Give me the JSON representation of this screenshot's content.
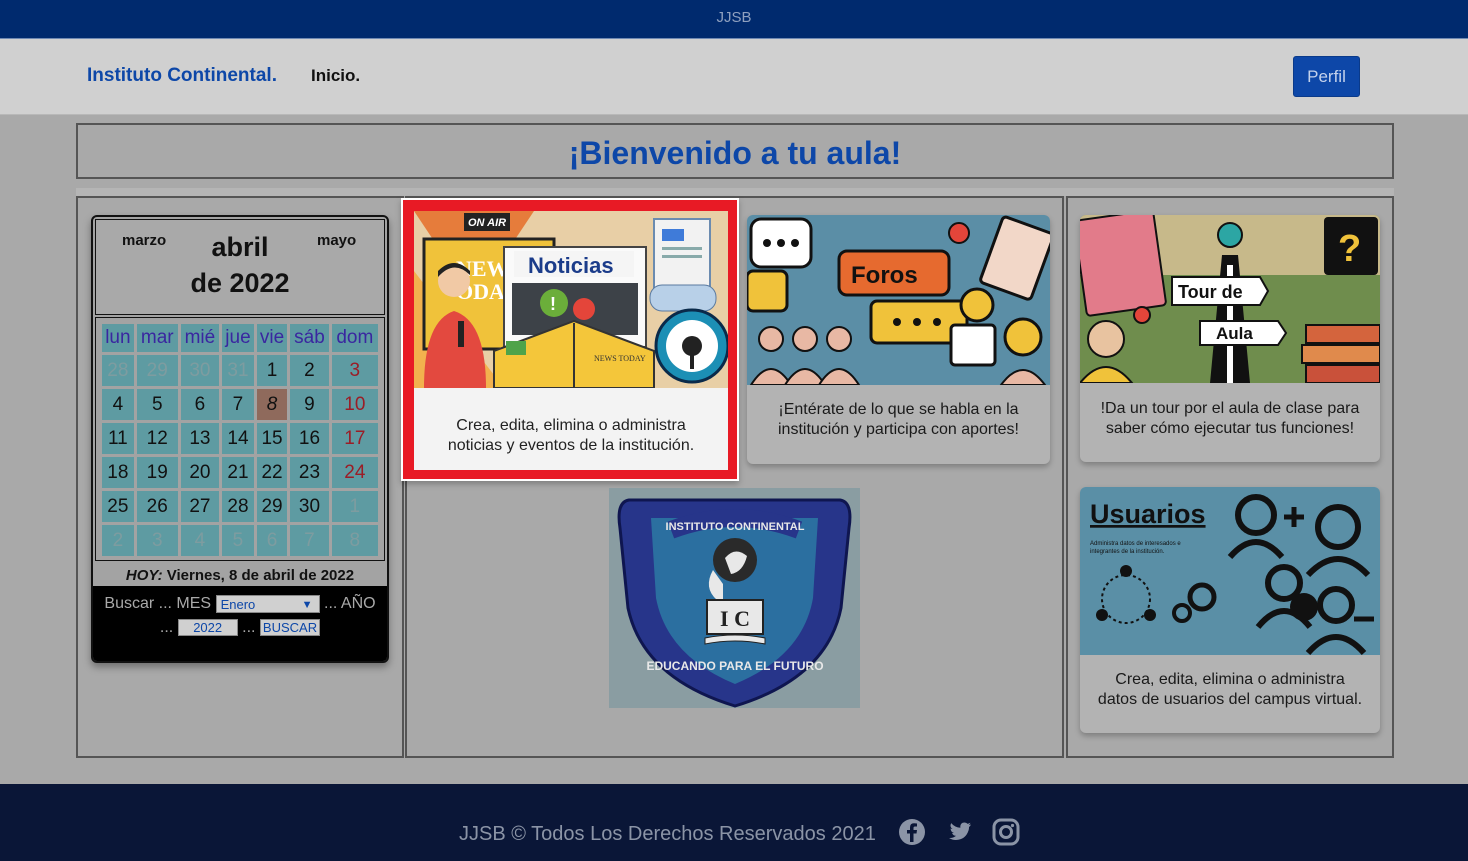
{
  "topbar": {
    "title": "JJSB"
  },
  "navbar": {
    "brand": "Instituto Continental.",
    "home_link": "Inicio.",
    "profile_button": "Perfil"
  },
  "welcome": {
    "heading": "¡Bienvenido a tu aula!"
  },
  "calendar": {
    "prev_month": "marzo",
    "month": "abril",
    "year_line": "de 2022",
    "next_month": "mayo",
    "weekdays": [
      "lun",
      "mar",
      "mié",
      "jue",
      "vie",
      "sáb",
      "dom"
    ],
    "weeks": [
      [
        "28",
        "29",
        "30",
        "31",
        "1",
        "2",
        "3"
      ],
      [
        "4",
        "5",
        "6",
        "7",
        "8",
        "9",
        "10"
      ],
      [
        "11",
        "12",
        "13",
        "14",
        "15",
        "16",
        "17"
      ],
      [
        "18",
        "19",
        "20",
        "21",
        "22",
        "23",
        "24"
      ],
      [
        "25",
        "26",
        "27",
        "28",
        "29",
        "30",
        "1"
      ],
      [
        "2",
        "3",
        "4",
        "5",
        "6",
        "7",
        "8"
      ]
    ],
    "today_label": "HOY:",
    "today_value": "Viernes, 8 de abril de 2022",
    "search": {
      "buscar_label": "Buscar ... MES",
      "month_value": "Enero",
      "year_label": "... AÑO",
      "dots": "...",
      "year_value": "2022",
      "dots2": "...",
      "button": "BUSCAR"
    }
  },
  "cards": {
    "noticias": {
      "title": "Noticias",
      "badge": "ON AIR",
      "description": "Crea, edita, elimina o administra noticias y eventos de la institución."
    },
    "foros": {
      "title": "Foros",
      "description": "¡Entérate de lo que se habla en la institución y participa con aportes!"
    },
    "tour": {
      "title_top": "Tour de",
      "title_bottom": "Aula",
      "description": "!Da un tour por el aula de clase para saber cómo ejecutar tus funciones!"
    },
    "usuarios": {
      "title": "Usuarios",
      "subtitle": "Administra datos de interesados e integrantes de la institución.",
      "description": "Crea, edita, elimina o administra datos de usuarios del campus virtual."
    }
  },
  "logo": {
    "top_text": "INSTITUTO CONTINENTAL",
    "bottom_text": "EDUCANDO PARA EL FUTURO",
    "initials": "I C"
  },
  "footer": {
    "text": "JJSB © Todos Los Derechos Reservados 2021"
  },
  "colors": {
    "primary": "#0d47a8",
    "topbar": "#002a6e",
    "footer": "#0a1637",
    "highlight": "#e81a25"
  }
}
